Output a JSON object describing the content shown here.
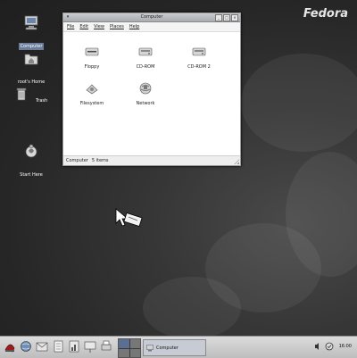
{
  "desktop": {
    "brand": "Fedora",
    "icons": [
      {
        "label": "Computer",
        "icon": "computer-icon"
      },
      {
        "label": "root's Home",
        "icon": "home-folder-icon"
      },
      {
        "label": "Trash",
        "icon": "trash-icon"
      },
      {
        "label": "Start Here",
        "icon": "start-here-icon"
      }
    ]
  },
  "window": {
    "title": "Computer",
    "menu": [
      "File",
      "Edit",
      "View",
      "Places",
      "Help"
    ],
    "items": [
      {
        "label": "Floppy",
        "icon": "floppy-drive-icon"
      },
      {
        "label": "CD-ROM",
        "icon": "cdrom-drive-icon"
      },
      {
        "label": "CD-ROM 2",
        "icon": "cdrom-drive-2-icon"
      },
      {
        "label": "Filesystem",
        "icon": "filesystem-icon"
      },
      {
        "label": "Network",
        "icon": "network-icon"
      }
    ],
    "status": {
      "location": "Computer",
      "count": "5 items"
    }
  },
  "taskbar": {
    "launchers": [
      "fedora-menu-icon",
      "web-browser-icon",
      "email-icon",
      "office-writer-icon",
      "office-calc-icon",
      "office-impress-icon",
      "print-manager-icon"
    ],
    "task": "Computer",
    "clock": "16:00"
  }
}
